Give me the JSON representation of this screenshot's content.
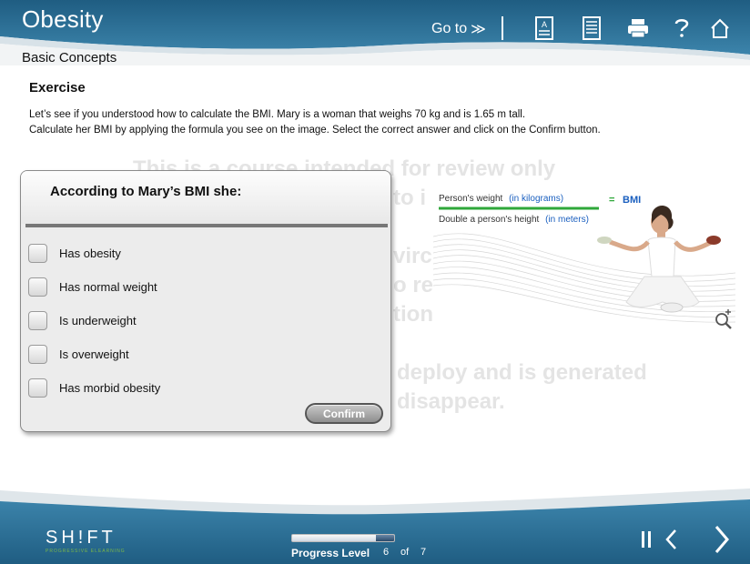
{
  "header": {
    "course_title": "Obesity",
    "section": "Basic Concepts",
    "goto_label": "Go to",
    "goto_chevron": "≫",
    "icons": [
      "summary-icon",
      "document-icon",
      "print-icon",
      "help-icon",
      "home-icon"
    ]
  },
  "exercise": {
    "title": "Exercise",
    "line1": "Let’s see if you understood how to calculate the BMI. Mary is a woman that weighs 70 kg and is 1.65 m tall.",
    "line2": "Calculate her BMI by applying the formula you see on the image. Select the correct answer and click on the Confirm button."
  },
  "watermark": {
    "line1": "This is a course intended for review only",
    "line2": "to i",
    "line3": "virc",
    "line4": "o rei",
    "line5": "tion",
    "line6": "deploy and is generated",
    "line7": "disappear."
  },
  "question": {
    "prompt": "According to Mary’s BMI she:",
    "options": [
      "Has obesity",
      "Has normal weight",
      "Is underweight",
      "Is overweight",
      "Has morbid obesity"
    ],
    "confirm_label": "Confirm"
  },
  "figure": {
    "numerator_prefix": "Person's weight",
    "numerator_unit": "(in kilograms)",
    "denominator_prefix": "Double a person's height",
    "denominator_unit": "(in meters)",
    "equals": "=",
    "result": "BMI"
  },
  "footer": {
    "brand": "SH!FT",
    "brand_tagline": "PROGRESSIVE ELEARNING",
    "progress_label": "Progress Level",
    "current_page": "6",
    "of_label": "of",
    "total_pages": "7",
    "progress_fraction": 0.857
  },
  "colors": {
    "header_blue": "#2a6c93",
    "accent_blue": "#1a5fbf",
    "accent_green": "#2fa83a"
  }
}
